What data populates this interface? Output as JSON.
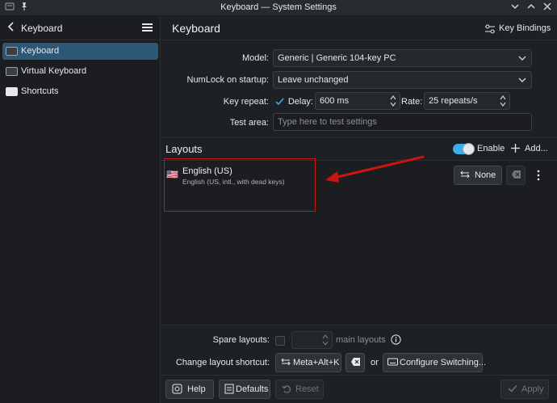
{
  "window": {
    "title": "Keyboard — System Settings"
  },
  "sidebar": {
    "title": "Keyboard",
    "items": [
      {
        "label": "Keyboard"
      },
      {
        "label": "Virtual Keyboard"
      },
      {
        "label": "Shortcuts"
      }
    ]
  },
  "main": {
    "title": "Keyboard",
    "key_bindings_label": "Key Bindings"
  },
  "form": {
    "model_label": "Model:",
    "model_value": "Generic | Generic 104-key PC",
    "numlock_label": "NumLock on startup:",
    "numlock_value": "Leave unchanged",
    "key_repeat_label": "Key repeat:",
    "delay_label": "Delay:",
    "delay_value": "600 ms",
    "rate_label": "Rate:",
    "rate_value": "25 repeats/s",
    "test_area_label": "Test area:",
    "test_area_placeholder": "Type here to test settings"
  },
  "layouts": {
    "title": "Layouts",
    "enable_label": "Enable",
    "add_label": "Add...",
    "items": [
      {
        "name": "English (US)",
        "description": "English (US, intl., with dead keys)",
        "flag": "🇺🇸",
        "shortcut_label": "None"
      }
    ]
  },
  "options": {
    "spare_label": "Spare layouts:",
    "main_layouts_label": "main layouts",
    "change_shortcut_label": "Change layout shortcut:",
    "shortcut_value": "Meta+Alt+K",
    "or_label": "or",
    "configure_label": "Configure Switching..."
  },
  "footer": {
    "help_label": "Help",
    "defaults_label": "Defaults",
    "reset_label": "Reset",
    "apply_label": "Apply"
  },
  "colors": {
    "accent": "#3daee9",
    "selection": "#2c5777",
    "annotation": "#d01212"
  }
}
